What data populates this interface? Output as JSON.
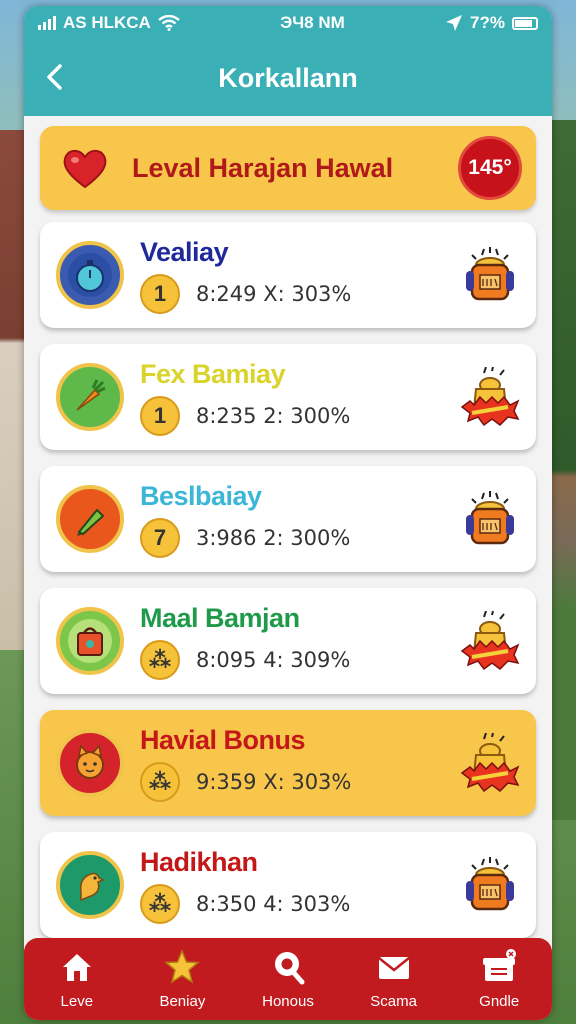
{
  "status": {
    "carrier": "AS HLKCA",
    "time": "ЭЧ8 NM",
    "battery": "7?%"
  },
  "header": {
    "title": "Korkallann"
  },
  "banner": {
    "text": "Leval Harajan Hawal",
    "badge": "145°"
  },
  "items": [
    {
      "name": "Vealiay",
      "name_color": "#1f2a9a",
      "coin": "1",
      "stats": "8:249  X: 303%",
      "icon": "stopwatch-icon",
      "ring_color": "#3a5bb0",
      "reward": "mug-reward-icon"
    },
    {
      "name": "Fex Bamiay",
      "name_color": "#d9d32a",
      "coin": "1",
      "stats": "8:235  2: 300%",
      "icon": "carrot-icon",
      "ring_color": "#5fb94a",
      "reward": "gold-bonus-icon"
    },
    {
      "name": "Beslbaiay",
      "name_color": "#3bb6d6",
      "coin": "7",
      "stats": "3:986  2: 300%",
      "icon": "marker-icon",
      "ring_color": "#e9571d",
      "reward": "mug-reward-icon"
    },
    {
      "name": "Maal Bamjan",
      "name_color": "#1f9a4a",
      "coin": "⁂",
      "stats": "8:095  4: 309%",
      "icon": "bag-icon",
      "ring_color": "#7cc64a",
      "reward": "gold-bonus-icon"
    },
    {
      "name": "Havial Bonus",
      "name_color": "#c41818",
      "coin": "⁂",
      "stats": "9:359  X: 303%",
      "icon": "cat-icon",
      "ring_color": "#d4232a",
      "reward": "gold-bonus-icon",
      "highlight": true
    },
    {
      "name": "Hadikhan",
      "name_color": "#c41818",
      "coin": "⁂",
      "stats": "8:350  4: 303%",
      "icon": "bird-icon",
      "ring_color": "#1e9a6a",
      "reward": "mug-reward-icon"
    }
  ],
  "nav": [
    {
      "label": "Leve",
      "icon": "home-icon"
    },
    {
      "label": "Beniay",
      "icon": "star-icon"
    },
    {
      "label": "Honous",
      "icon": "search-icon"
    },
    {
      "label": "Scama",
      "icon": "mail-icon"
    },
    {
      "label": "Gndle",
      "icon": "gift-icon"
    }
  ]
}
